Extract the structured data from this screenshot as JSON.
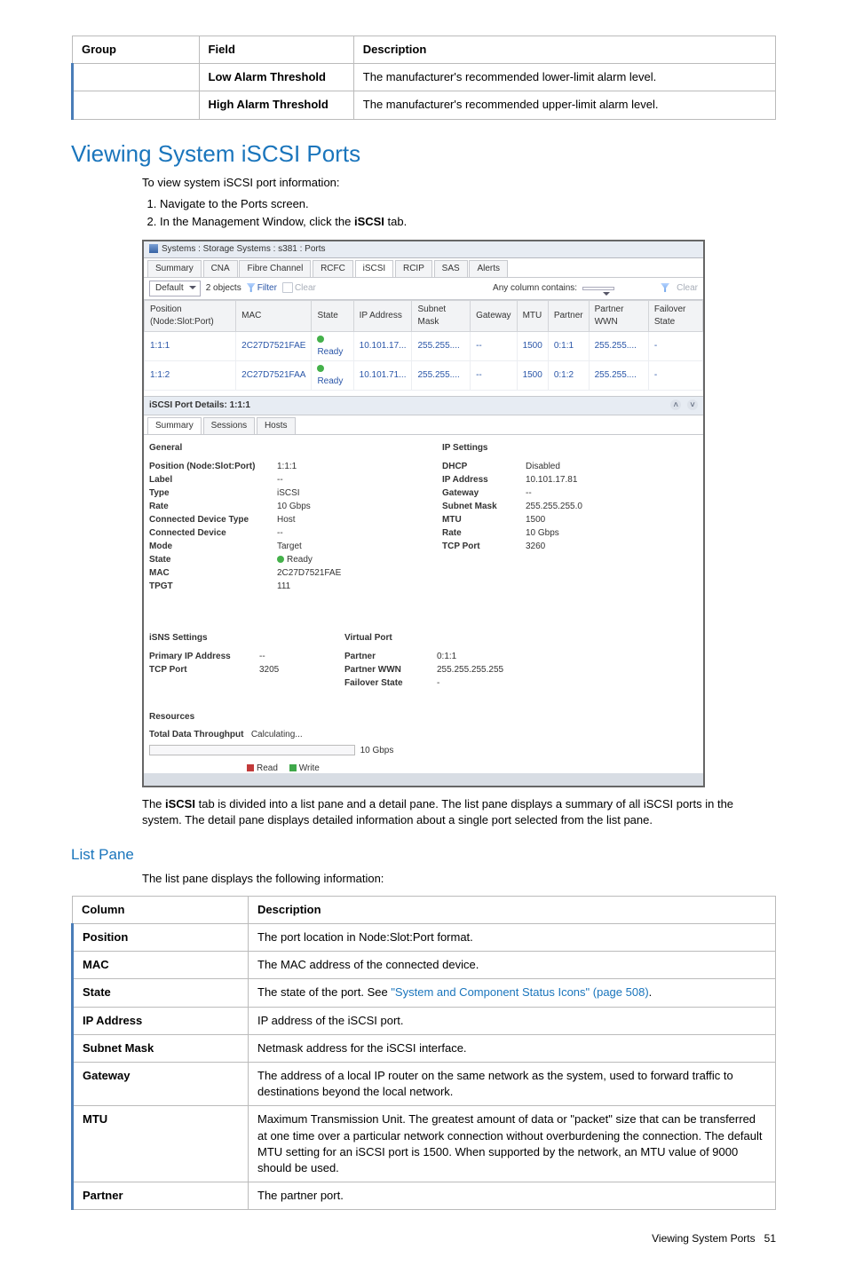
{
  "top_table": {
    "headers": [
      "Group",
      "Field",
      "Description"
    ],
    "rows": [
      {
        "group": "",
        "field": "Low Alarm Threshold",
        "desc": "The manufacturer's recommended lower-limit alarm level."
      },
      {
        "group": "",
        "field": "High Alarm Threshold",
        "desc": "The manufacturer's recommended upper-limit alarm level."
      }
    ]
  },
  "section_title": "Viewing System iSCSI Ports",
  "intro": "To view system iSCSI port information:",
  "steps": [
    "Navigate to the Ports screen.",
    "In the Management Window, click the iSCSI tab."
  ],
  "step2_prefix": "In the Management Window, click the ",
  "step2_bold": "iSCSI",
  "step2_suffix": " tab.",
  "screenshot": {
    "title": "Systems : Storage Systems : s381 : Ports",
    "tabs": [
      "Summary",
      "CNA",
      "Fibre Channel",
      "RCFC",
      "iSCSI",
      "RCIP",
      "SAS",
      "Alerts"
    ],
    "active_tab": "iSCSI",
    "toolbar": {
      "view_label": "Default",
      "count": "2 objects",
      "filter": "Filter",
      "clear": "Clear",
      "right_label": "Any column contains:",
      "right_clear": "Clear"
    },
    "columns": [
      "Position (Node:Slot:Port)",
      "MAC",
      "State",
      "IP Address",
      "Subnet Mask",
      "Gateway",
      "MTU",
      "Partner",
      "Partner WWN",
      "Failover State"
    ],
    "rows": [
      {
        "pos": "1:1:1",
        "mac": "2C27D7521FAE",
        "state": "Ready",
        "ip": "10.101.17...",
        "mask": "255.255....",
        "gw": "--",
        "mtu": "1500",
        "partner": "0:1:1",
        "pwwn": "255.255....",
        "fail": "-"
      },
      {
        "pos": "1:1:2",
        "mac": "2C27D7521FAA",
        "state": "Ready",
        "ip": "10.101.71...",
        "mask": "255.255....",
        "gw": "--",
        "mtu": "1500",
        "partner": "0:1:2",
        "pwwn": "255.255....",
        "fail": "-"
      }
    ],
    "detail_header": "iSCSI Port Details: 1:1:1",
    "detail_tabs": [
      "Summary",
      "Sessions",
      "Hosts"
    ],
    "general_heading": "General",
    "general": [
      {
        "k": "Position (Node:Slot:Port)",
        "v": "1:1:1"
      },
      {
        "k": "Label",
        "v": "--"
      },
      {
        "k": "Type",
        "v": "iSCSI"
      },
      {
        "k": "Rate",
        "v": "10 Gbps"
      },
      {
        "k": "Connected Device Type",
        "v": "Host"
      },
      {
        "k": "Connected Device",
        "v": "--"
      },
      {
        "k": "Mode",
        "v": "Target"
      },
      {
        "k": "State",
        "v": "Ready",
        "dot": true
      },
      {
        "k": "MAC",
        "v": "2C27D7521FAE"
      },
      {
        "k": "TPGT",
        "v": "111"
      }
    ],
    "ip_heading": "IP Settings",
    "ip": [
      {
        "k": "DHCP",
        "v": "Disabled"
      },
      {
        "k": "IP Address",
        "v": "10.101.17.81"
      },
      {
        "k": "Gateway",
        "v": "--"
      },
      {
        "k": "Subnet Mask",
        "v": "255.255.255.0"
      },
      {
        "k": "MTU",
        "v": "1500"
      },
      {
        "k": "Rate",
        "v": "10 Gbps"
      },
      {
        "k": "TCP Port",
        "v": "3260"
      }
    ],
    "isns_heading": "iSNS Settings",
    "isns": [
      {
        "k": "Primary IP Address",
        "v": "--"
      },
      {
        "k": "TCP Port",
        "v": "3205"
      }
    ],
    "vp_heading": "Virtual Port",
    "vp": [
      {
        "k": "Partner",
        "v": "0:1:1",
        "blue": true
      },
      {
        "k": "Partner WWN",
        "v": "255.255.255.255"
      },
      {
        "k": "Failover State",
        "v": "-"
      }
    ],
    "resources_heading": "Resources",
    "throughput_label": "Total Data Throughput",
    "throughput_value": "Calculating...",
    "bar_max": "10 Gbps",
    "legend_read": "Read",
    "legend_write": "Write"
  },
  "body1_prefix": "The ",
  "body1_bold": "iSCSI",
  "body1_suffix": " tab is divided into a list pane and a detail pane. The list pane displays a summary of all iSCSI ports in the system. The detail pane displays detailed information about a single port selected from the list pane.",
  "list_pane_heading": "List Pane",
  "list_pane_intro": "The list pane displays the following information:",
  "list_table": {
    "headers": [
      "Column",
      "Description"
    ],
    "rows": [
      {
        "col": "Position",
        "desc": "The port location in Node:Slot:Port format."
      },
      {
        "col": "MAC",
        "desc": "The MAC address of the connected device."
      },
      {
        "col": "State",
        "desc_prefix": "The state of the port. See ",
        "desc_link": "\"System and Component Status Icons\" (page 508)",
        "desc_suffix": "."
      },
      {
        "col": "IP Address",
        "desc": "IP address of the iSCSI port."
      },
      {
        "col": "Subnet Mask",
        "desc": "Netmask address for the iSCSI interface."
      },
      {
        "col": "Gateway",
        "desc": "The address of a local IP router on the same network as the system, used to forward traffic to destinations beyond the local network."
      },
      {
        "col": "MTU",
        "desc": "Maximum Transmission Unit. The greatest amount of data or \"packet\" size that can be transferred at one time over a particular network connection without overburdening the connection. The default MTU setting for an iSCSI port is 1500. When supported by the network, an MTU value of 9000 should be used."
      },
      {
        "col": "Partner",
        "desc": "The partner port."
      }
    ]
  },
  "footer_text": "Viewing System Ports",
  "footer_page": "51"
}
